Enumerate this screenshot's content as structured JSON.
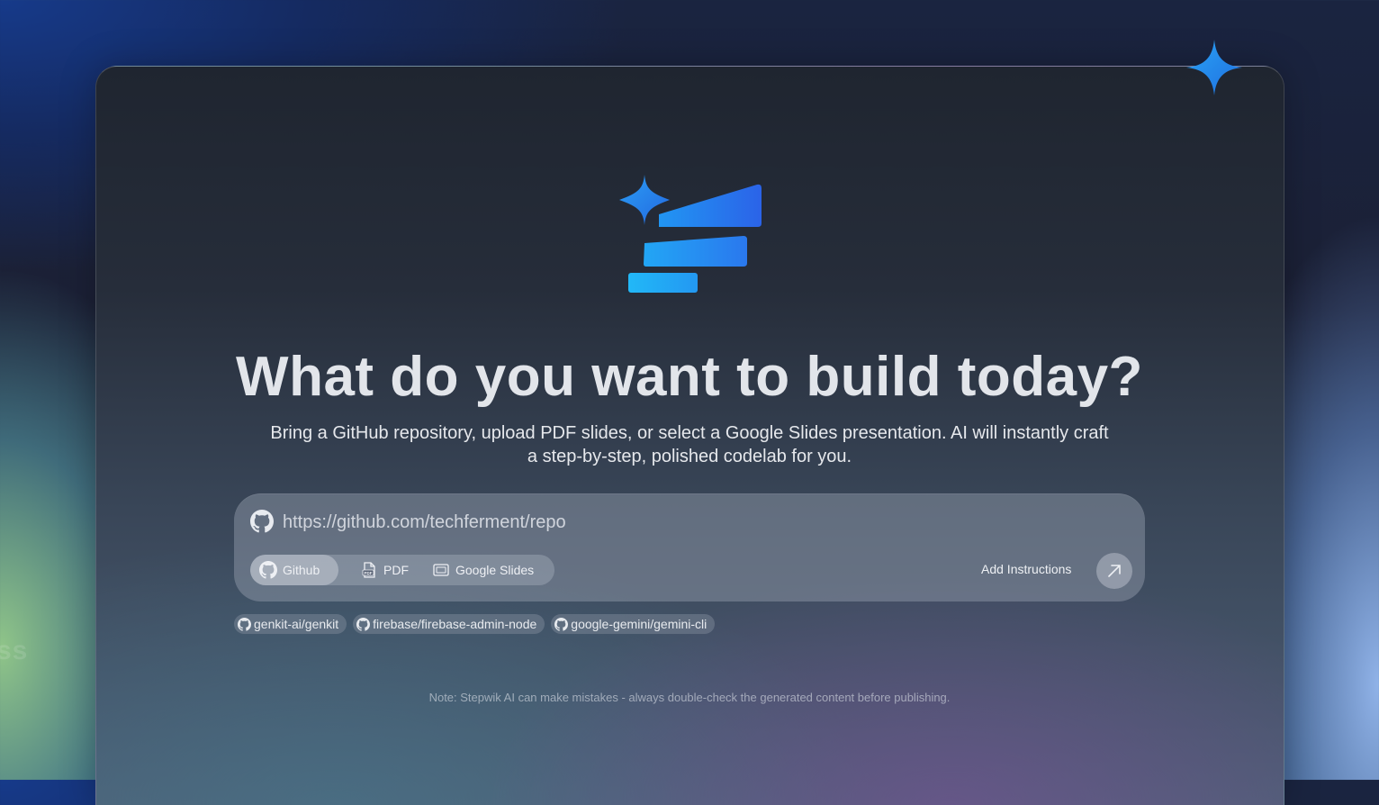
{
  "hero": {
    "title": "What do you want to build today?",
    "subtitle_line1": "Bring a GitHub repository, upload PDF slides, or select a Google Slides presentation. AI will instantly craft",
    "subtitle_line2": "a step-by-step, polished codelab for you."
  },
  "input": {
    "placeholder": "https://github.com/techferment/repo",
    "value": ""
  },
  "sources": [
    {
      "label": "Github",
      "icon": "github-icon",
      "selected": true
    },
    {
      "label": "PDF",
      "icon": "pdf-icon",
      "selected": false
    },
    {
      "label": "Google Slides",
      "icon": "slides-icon",
      "selected": false
    }
  ],
  "actions": {
    "add_instructions": "Add Instructions",
    "submit_icon": "arrow-up-right-icon"
  },
  "suggestions": [
    "genkit-ai/genkit",
    "firebase/firebase-admin-node",
    "google-gemini/gemini-cli"
  ],
  "footer": {
    "note": "Note: Stepwik AI can make mistakes - always double-check the generated content before publishing."
  },
  "background": {
    "ghost_text": "ss"
  },
  "colors": {
    "accent": "#2f7ff0",
    "accent_light": "#22b8f5"
  }
}
